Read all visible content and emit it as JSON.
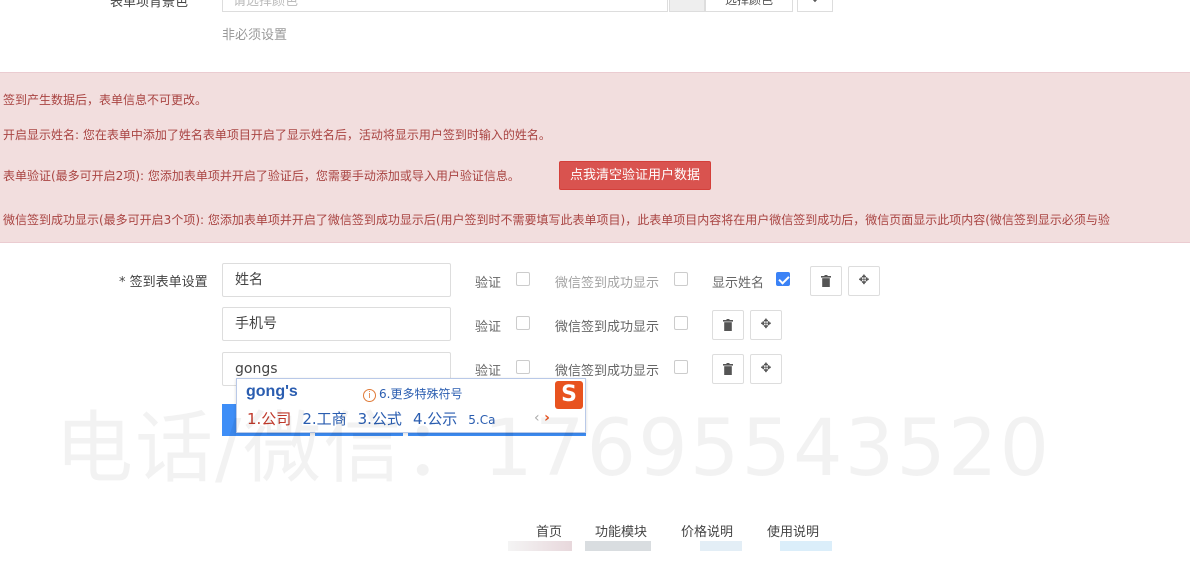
{
  "top_row": {
    "label": "表单项背景色",
    "placeholder": "请选择颜色",
    "pick_button": "选择颜色",
    "clear_icon": "arrows-icon",
    "hint": "非必须设置"
  },
  "notice": {
    "line1": "签到产生数据后，表单信息不可更改。",
    "line2": "开启显示姓名: 您在表单中添加了姓名表单项目开启了显示姓名后，活动将显示用户签到时输入的姓名。",
    "line3": "表单验证(最多可开启2项): 您添加表单项并开启了验证后，您需要手动添加或导入用户验证信息。",
    "clear_button": "点我清空验证用户数据",
    "line4": "微信签到成功显示(最多可开启3个项): 您添加表单项并开启了微信签到成功显示后(用户签到时不需要填写此表单项目)，此表单项目内容将在用户微信签到成功后，微信页面显示此项内容(微信签到显示必须与验"
  },
  "form": {
    "label": "* 签到表单设置",
    "rows": [
      {
        "value": "姓名",
        "verify": "验证",
        "wechat": "微信签到成功显示",
        "show_name": "显示姓名"
      },
      {
        "value": "手机号",
        "verify": "验证",
        "wechat": "微信签到成功显示"
      },
      {
        "value": "gongs",
        "verify": "验证",
        "wechat": "微信签到成功显示"
      }
    ]
  },
  "ime": {
    "composition": "gong's",
    "more": "6.更多特殊符号",
    "candidates": [
      "1.公司",
      "2.工商",
      "3.公式",
      "4.公示",
      "5.Ca"
    ],
    "logo": "S"
  },
  "watermark": "电话/微信：17695543520",
  "footer": {
    "items": [
      "首页",
      "功能模块",
      "价格说明",
      "使用说明"
    ]
  },
  "colors": {
    "notice_bg": "#f2dede",
    "notice_text": "#a94442",
    "danger": "#d9534f",
    "primary": "#3e8ef7",
    "checkbox_on": "#3b82f6"
  }
}
